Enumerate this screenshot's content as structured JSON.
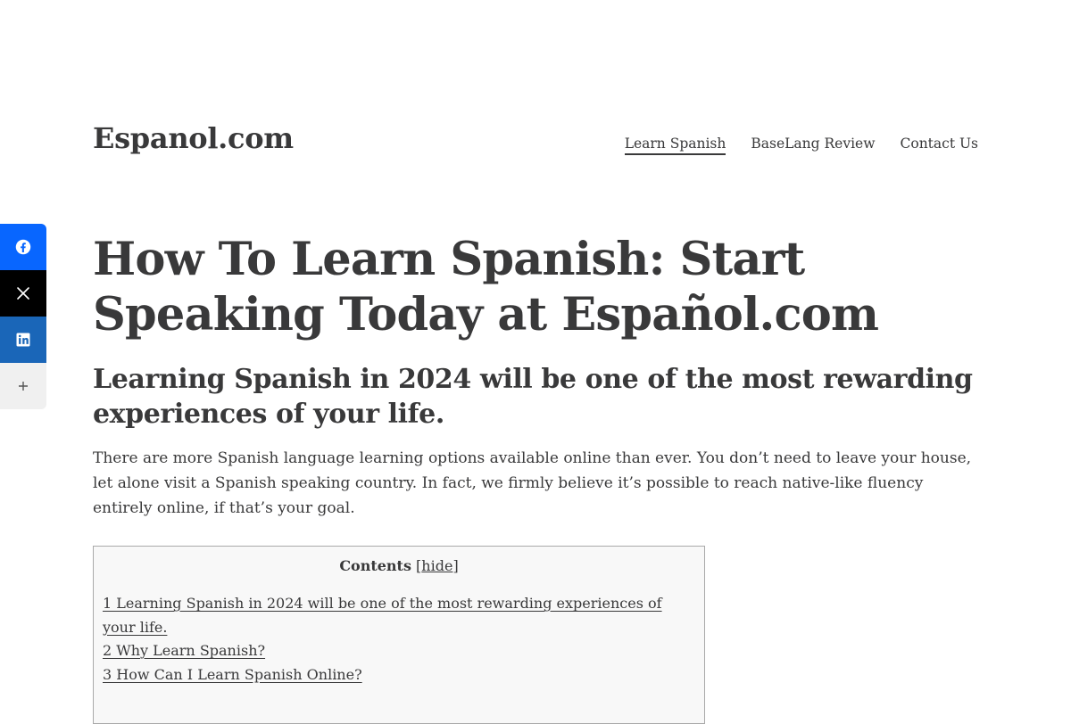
{
  "site": {
    "title": "Espanol.com"
  },
  "nav": {
    "items": [
      {
        "label": "Learn Spanish",
        "current": true
      },
      {
        "label": "BaseLang Review"
      },
      {
        "label": "Contact Us"
      }
    ]
  },
  "share": {
    "buttons": [
      {
        "icon": "facebook-icon",
        "color": "#0866ff"
      },
      {
        "icon": "x-icon",
        "color": "#000000"
      },
      {
        "icon": "linkedin-icon",
        "color": "#1a66b8"
      },
      {
        "icon": "plus-icon",
        "color": "#f0f0f0"
      }
    ]
  },
  "article": {
    "title": "How To Learn Spanish: Start Speaking Today at Español.com",
    "subheading": "Learning Spanish in 2024 will be one of the most rewarding experiences of your life.",
    "intro": "There are more Spanish language learning options available online than ever. You don’t need to leave your house, let alone visit a Spanish speaking country. In fact, we firmly believe it’s possible to reach native-like fluency entirely online, if that’s your goal."
  },
  "toc": {
    "label": "Contents",
    "bracket_open": "[",
    "toggle": "hide",
    "bracket_close": "]",
    "items": [
      "1 Learning Spanish in 2024 will be one of the most rewarding experiences of your life.",
      "2 Why Learn Spanish?",
      "3 How Can I Learn Spanish Online?"
    ]
  }
}
